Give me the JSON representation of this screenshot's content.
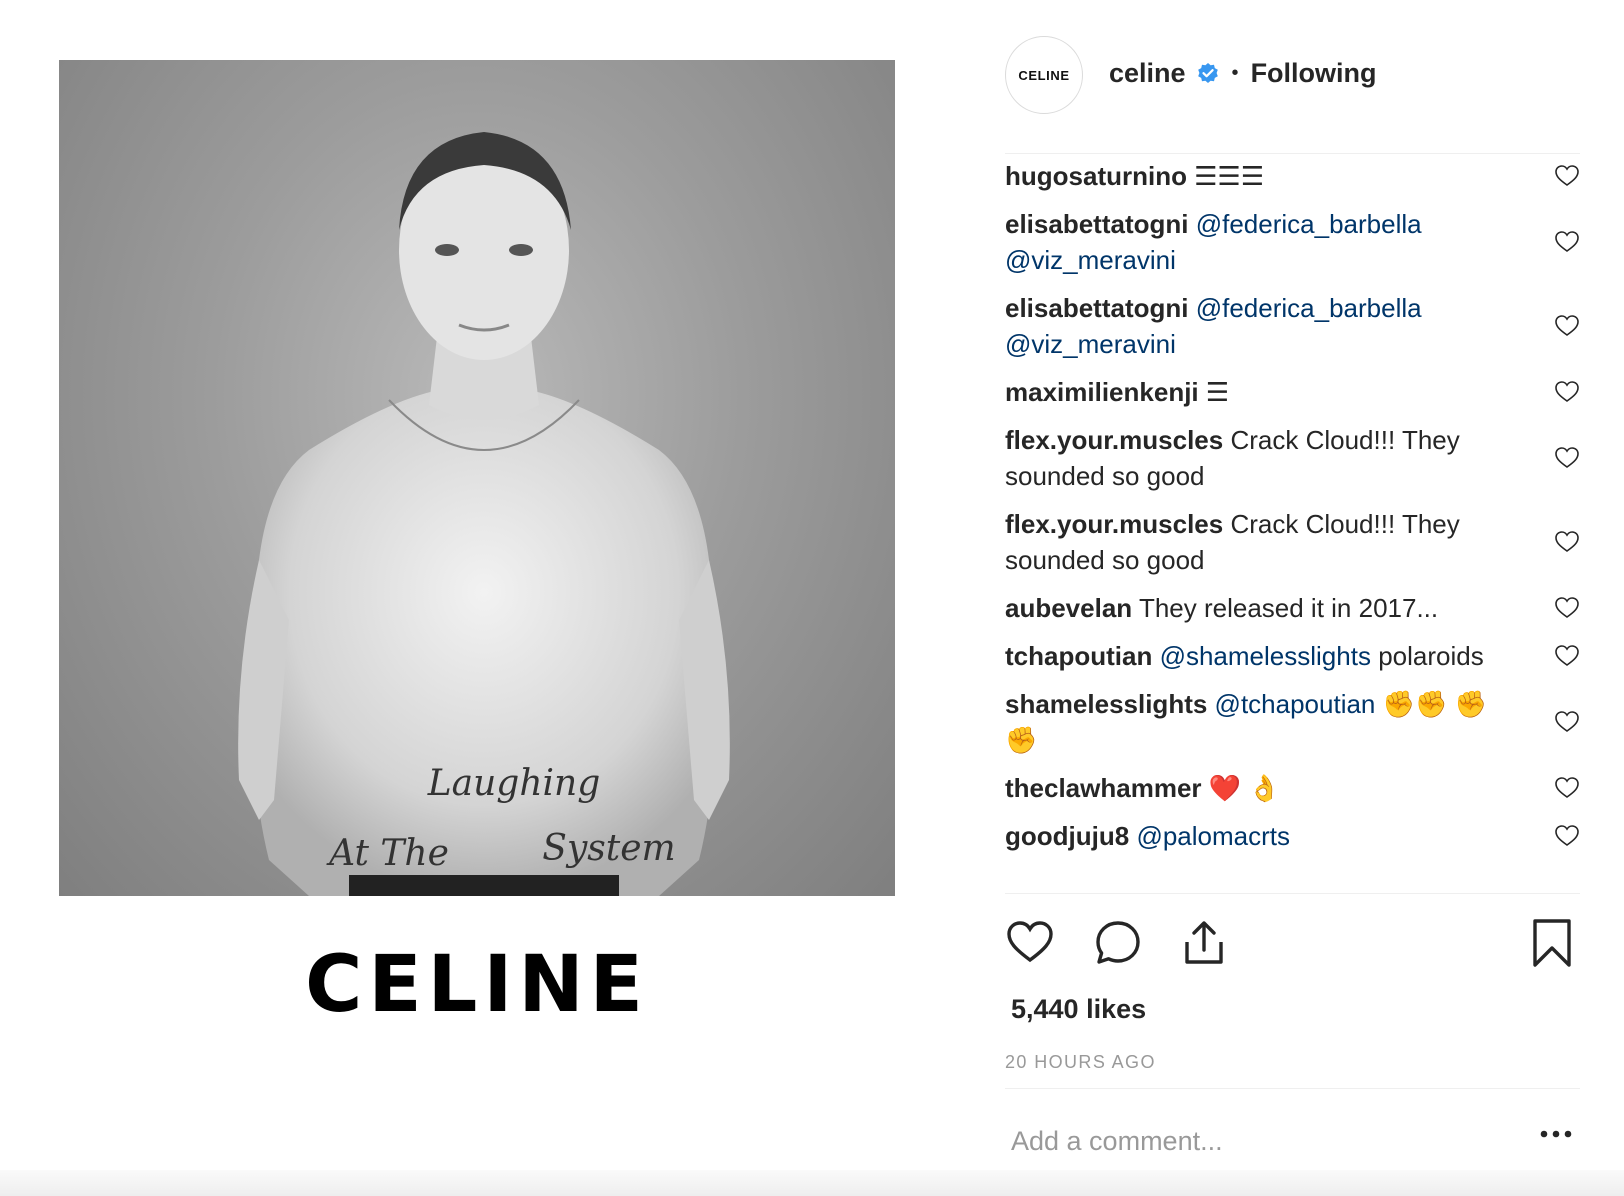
{
  "post": {
    "brand_wordmark": "CELINE",
    "image_text": [
      "Laughing",
      "At The",
      "System"
    ]
  },
  "header": {
    "avatar_text": "CELINE",
    "username": "celine",
    "separator": "•",
    "follow_status": "Following"
  },
  "comments": [
    {
      "user": "hugosaturnino",
      "text": "☰☰☰",
      "mentions": []
    },
    {
      "user": "elisabettatogni",
      "text": "",
      "mentions": [
        "@federica_barbella",
        "@viz_meravini"
      ]
    },
    {
      "user": "elisabettatogni",
      "text": "",
      "mentions": [
        "@federica_barbella",
        "@viz_meravini"
      ]
    },
    {
      "user": "maximilienkenji",
      "text": "☰",
      "mentions": []
    },
    {
      "user": "flex.your.muscles",
      "text": "Crack Cloud!!! They sounded so good",
      "mentions": []
    },
    {
      "user": "flex.your.muscles",
      "text": "Crack Cloud!!! They sounded so good",
      "mentions": []
    },
    {
      "user": "aubevelan",
      "text": "They released it in 2017...",
      "mentions": []
    },
    {
      "user": "tchapoutian",
      "text": "polaroids",
      "mentions": [
        "@shamelesslights"
      ],
      "mention_first": true
    },
    {
      "user": "shamelesslights",
      "text": "✊✊ ✊✊",
      "mentions": [
        "@tchapoutian"
      ],
      "mention_first": true
    },
    {
      "user": "theclawhammer",
      "text": "❤️ 👌",
      "mentions": []
    },
    {
      "user": "goodjuju8",
      "text": "",
      "mentions": [
        "@palomacrts"
      ]
    }
  ],
  "engagement": {
    "likes": "5,440 likes",
    "timestamp": "20 HOURS AGO"
  },
  "composer": {
    "placeholder": "Add a comment..."
  },
  "icons": {
    "verified": "verified-badge-icon",
    "like": "heart-icon",
    "comment": "comment-bubble-icon",
    "share": "share-icon",
    "save": "bookmark-icon",
    "more": "more-options-icon"
  },
  "colors": {
    "verified": "#3897f0",
    "mention": "#003569",
    "muted": "#999999",
    "text": "#262626"
  }
}
